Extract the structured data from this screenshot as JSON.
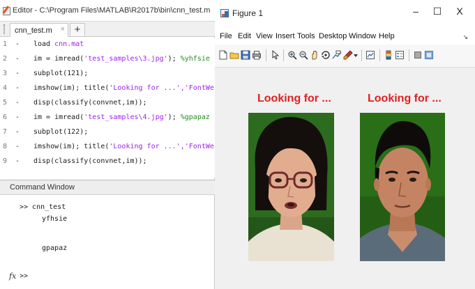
{
  "editor": {
    "title": "Editor - C:\\Program Files\\MATLAB\\R2017b\\bin\\cnn_test.m",
    "tab_label": "cnn_test.m",
    "tab_close": "×",
    "add_tab": "+",
    "lines": [
      {
        "num": "1",
        "dash": "-",
        "code": "load ",
        "str": "cnn.mat",
        "code2": "",
        "cmt": ""
      },
      {
        "num": "2",
        "dash": "-",
        "code": "im = imread(",
        "str": "'test_samples\\3.jpg'",
        "code2": "); ",
        "cmt": "%yhfsie"
      },
      {
        "num": "3",
        "dash": "-",
        "code": "subplot(121);",
        "str": "",
        "code2": "",
        "cmt": ""
      },
      {
        "num": "4",
        "dash": "-",
        "code": "imshow(im); title(",
        "str": "'Looking for ...','FontWei",
        "code2": "",
        "cmt": ""
      },
      {
        "num": "5",
        "dash": "-",
        "code": "disp(classify(convnet,im));",
        "str": "",
        "code2": "",
        "cmt": ""
      },
      {
        "num": "6",
        "dash": "-",
        "code": "im = imread(",
        "str": "'test_samples\\4.jpg'",
        "code2": "); ",
        "cmt": "%gpapaz"
      },
      {
        "num": "7",
        "dash": "-",
        "code": "subplot(122);",
        "str": "",
        "code2": "",
        "cmt": ""
      },
      {
        "num": "8",
        "dash": "-",
        "code": "imshow(im); title(",
        "str": "'Looking for ...','FontWei",
        "code2": "",
        "cmt": ""
      },
      {
        "num": "9",
        "dash": "-",
        "code": "disp(classify(convnet,im));",
        "str": "",
        "code2": "",
        "cmt": ""
      }
    ]
  },
  "command_window": {
    "header": "Command Window",
    "prompt_line": ">> cnn_test",
    "output_1": "yfhsie",
    "output_2": "gpapaz",
    "fx_label": "fx",
    "prompt_empty": ">>"
  },
  "figure": {
    "title": "Figure 1",
    "minimize": "–",
    "maximize": "☐",
    "close": "X",
    "menus": [
      "File",
      "Edit",
      "View",
      "Insert",
      "Tools",
      "Desktop",
      "Window",
      "Help"
    ],
    "menu_arrow": "↘",
    "subplots": [
      {
        "title": "Looking for ..."
      },
      {
        "title": "Looking for ..."
      }
    ]
  },
  "colors": {
    "code_string": "#a020f0",
    "code_comment": "#228b22",
    "subplot_title": "#e01f1f",
    "photo_bg_1": "#2d6b1e",
    "photo_bg_2": "#2a6e18"
  },
  "icons": {
    "editor_title": "matlab-editor-icon",
    "figure_title": "matlab-figure-icon",
    "toolbar": [
      "new-figure-icon",
      "open-file-icon",
      "save-icon",
      "print-icon",
      "arrow-pointer-icon",
      "zoom-in-icon",
      "zoom-out-icon",
      "pan-hand-icon",
      "rotate-3d-icon",
      "data-cursor-icon",
      "brush-icon",
      "link-plot-icon",
      "colorbar-icon",
      "legend-icon",
      "hide-plot-tools-icon",
      "show-plot-tools-icon"
    ]
  }
}
